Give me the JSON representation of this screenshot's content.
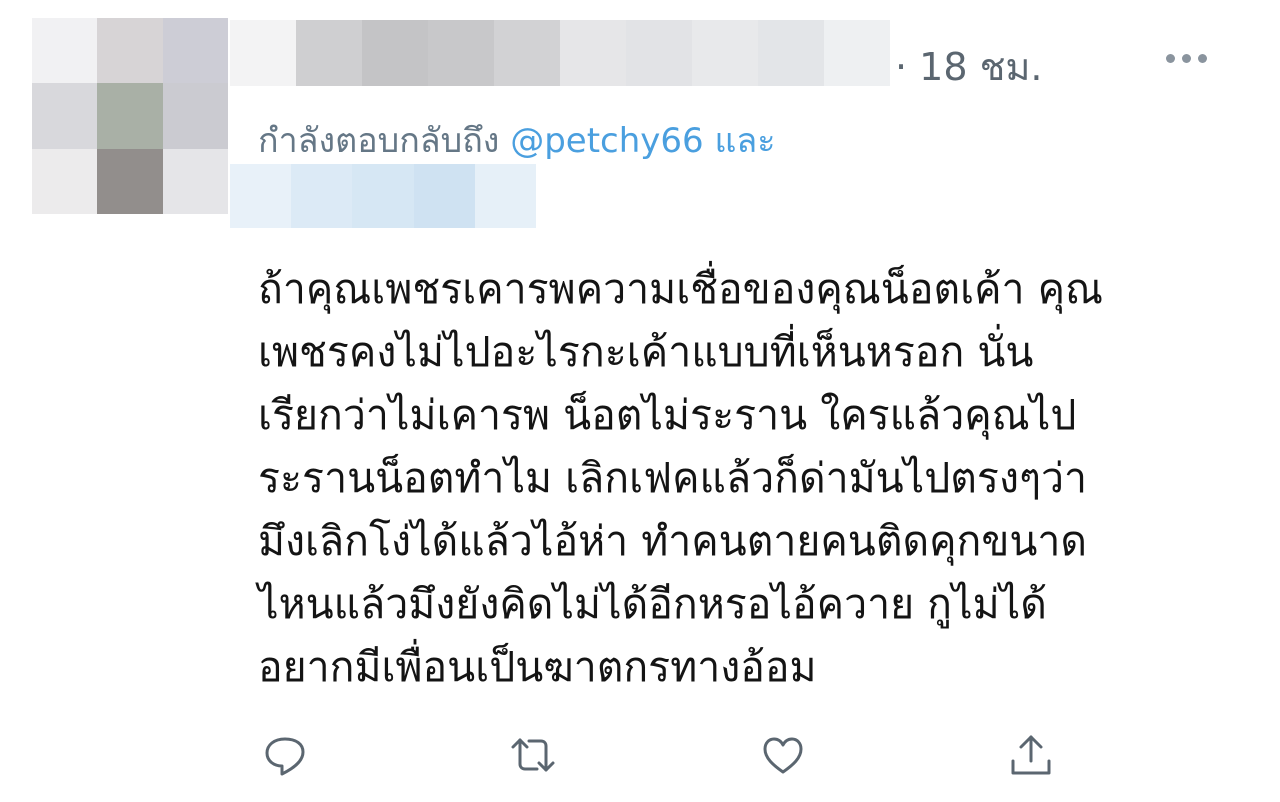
{
  "tweet": {
    "time": "· 18 ชม.",
    "reply": {
      "prefix": "กำลังตอบกลับถึง",
      "mention": "@petchy66",
      "suffix": "และ"
    },
    "text_lines": [
      "ถ้าคุณเพชรเคารพความเชื่อของคุณน็อตเค้า คุณ",
      "เพชรคงไม่ไปอะไรกะเค้าแบบที่เห็นหรอก นั่น",
      "เรียกว่าไม่เคารพ น็อตไม่ระราน ใครแล้วคุณไป",
      "ระรานน็อตทำไม เลิกเฟคแล้วก็ด่ามันไปตรงๆว่า",
      "มึงเลิกโง่ได้แล้วไอ้ห่า ทำคนตายคนติดคุกขนาด",
      "ไหนแล้วมึงยังคิดไม่ได้อีกหรอไอ้ควาย กูไม่ได้",
      "อยากมีเพื่อนเป็นฆาตกรทางอ้อม"
    ],
    "actions": [
      {
        "icon": "reply-icon"
      },
      {
        "icon": "retweet-icon"
      },
      {
        "icon": "like-icon"
      },
      {
        "icon": "share-icon"
      }
    ]
  },
  "colors": {
    "secondary_text": "#657786",
    "mention": "#4a9fdf",
    "icon": "#5b6670"
  }
}
